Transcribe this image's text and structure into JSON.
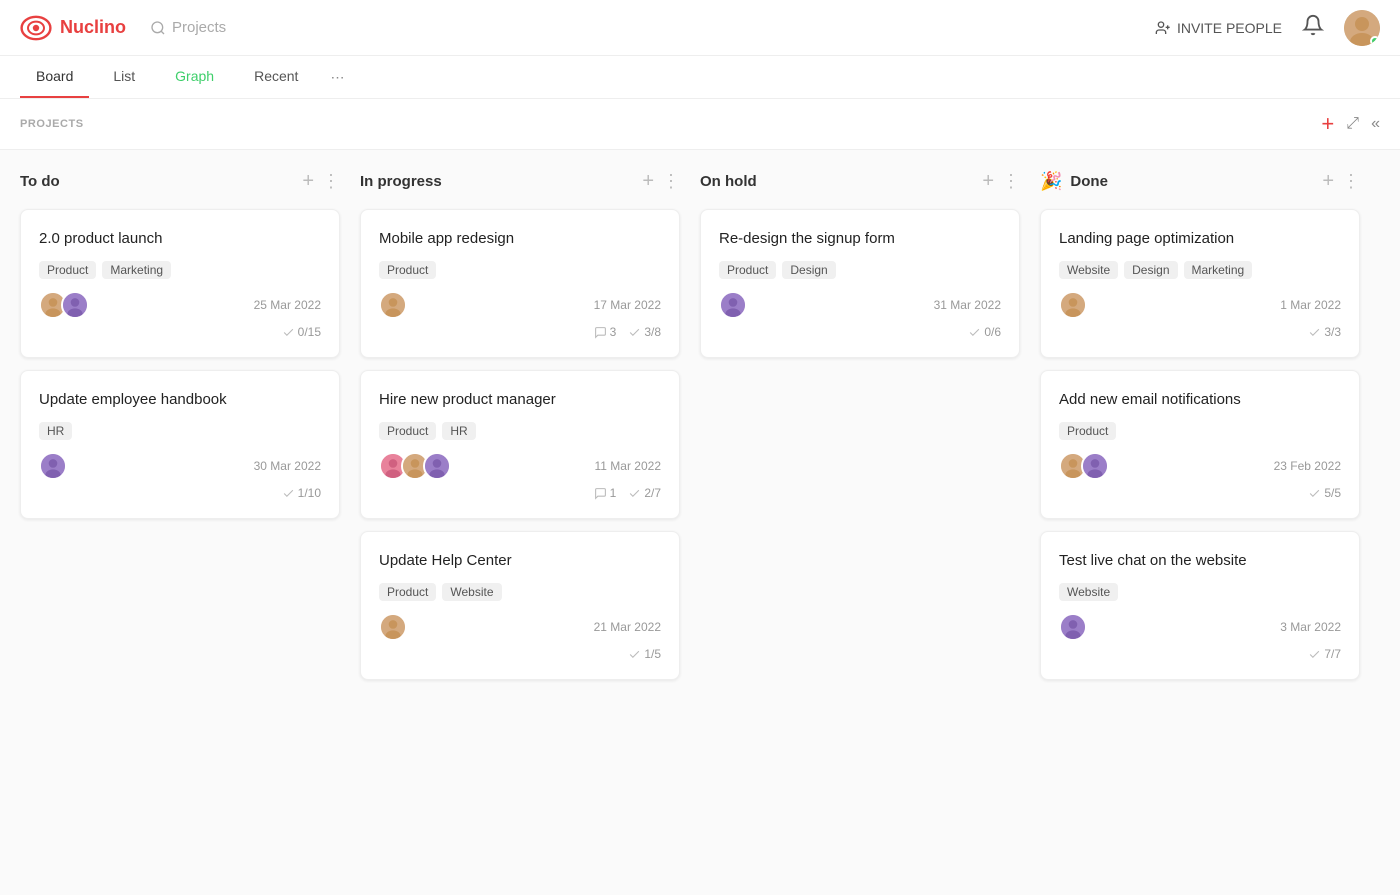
{
  "app": {
    "name": "Nuclino",
    "search_placeholder": "Projects"
  },
  "header": {
    "invite_label": "INVITE PEOPLE",
    "user_online": true
  },
  "tabs": [
    {
      "id": "board",
      "label": "Board",
      "active": true
    },
    {
      "id": "list",
      "label": "List",
      "active": false
    },
    {
      "id": "graph",
      "label": "Graph",
      "active": false
    },
    {
      "id": "recent",
      "label": "Recent",
      "active": false
    }
  ],
  "projects_label": "PROJECTS",
  "columns": [
    {
      "id": "todo",
      "title": "To do",
      "icon": "",
      "cards": [
        {
          "id": "card-1",
          "title": "2.0 product launch",
          "tags": [
            "Product",
            "Marketing"
          ],
          "date": "25 Mar 2022",
          "checks": "0/15",
          "comments": null,
          "avatars": [
            "brown",
            "purple"
          ]
        },
        {
          "id": "card-2",
          "title": "Update employee handbook",
          "tags": [
            "HR"
          ],
          "date": "30 Mar 2022",
          "checks": "1/10",
          "comments": null,
          "avatars": [
            "purple"
          ]
        }
      ]
    },
    {
      "id": "inprogress",
      "title": "In progress",
      "icon": "",
      "cards": [
        {
          "id": "card-3",
          "title": "Mobile app redesign",
          "tags": [
            "Product"
          ],
          "date": "17 Mar 2022",
          "checks": "3/8",
          "comments": "3",
          "avatars": [
            "brown"
          ]
        },
        {
          "id": "card-4",
          "title": "Hire new product manager",
          "tags": [
            "Product",
            "HR"
          ],
          "date": "11 Mar 2022",
          "checks": "2/7",
          "comments": "1",
          "avatars": [
            "pink",
            "brown",
            "purple"
          ]
        },
        {
          "id": "card-5",
          "title": "Update Help Center",
          "tags": [
            "Product",
            "Website"
          ],
          "date": "21 Mar 2022",
          "checks": "1/5",
          "comments": null,
          "avatars": [
            "brown"
          ]
        }
      ]
    },
    {
      "id": "onhold",
      "title": "On hold",
      "icon": "",
      "cards": [
        {
          "id": "card-6",
          "title": "Re-design the signup form",
          "tags": [
            "Product",
            "Design"
          ],
          "date": "31 Mar 2022",
          "checks": "0/6",
          "comments": null,
          "avatars": [
            "purple"
          ]
        }
      ]
    },
    {
      "id": "done",
      "title": "Done",
      "icon": "🎉",
      "cards": [
        {
          "id": "card-7",
          "title": "Landing page optimization",
          "tags": [
            "Website",
            "Design",
            "Marketing"
          ],
          "date": "1 Mar 2022",
          "checks": "3/3",
          "comments": null,
          "avatars": [
            "brown"
          ]
        },
        {
          "id": "card-8",
          "title": "Add new email notifications",
          "tags": [
            "Product"
          ],
          "date": "23 Feb 2022",
          "checks": "5/5",
          "comments": null,
          "avatars": [
            "brown",
            "purple"
          ]
        },
        {
          "id": "card-9",
          "title": "Test live chat on the website",
          "tags": [
            "Website"
          ],
          "date": "3 Mar 2022",
          "checks": "7/7",
          "comments": null,
          "avatars": [
            "purple"
          ]
        }
      ]
    }
  ]
}
